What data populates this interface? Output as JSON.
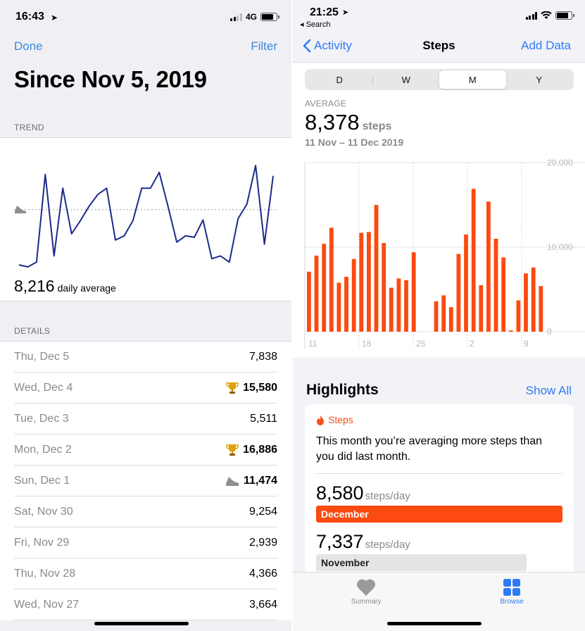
{
  "left": {
    "status": {
      "time": "16:43",
      "network": "4G"
    },
    "nav": {
      "done": "Done",
      "filter": "Filter"
    },
    "title": "Since Nov 5, 2019",
    "trend_header": "TREND",
    "average_value": "8,216",
    "average_label": "daily average",
    "details_header": "DETAILS",
    "details": [
      {
        "date": "Thu, Dec 5",
        "value": "7,838",
        "badge": ""
      },
      {
        "date": "Wed, Dec 4",
        "value": "15,580",
        "badge": "trophy-icon"
      },
      {
        "date": "Tue, Dec 3",
        "value": "5,511",
        "badge": ""
      },
      {
        "date": "Mon, Dec 2",
        "value": "16,886",
        "badge": "trophy-icon"
      },
      {
        "date": "Sun, Dec 1",
        "value": "11,474",
        "badge": "shoe-icon"
      },
      {
        "date": "Sat, Nov 30",
        "value": "9,254",
        "badge": ""
      },
      {
        "date": "Fri, Nov 29",
        "value": "2,939",
        "badge": ""
      },
      {
        "date": "Thu, Nov 28",
        "value": "4,366",
        "badge": ""
      },
      {
        "date": "Wed, Nov 27",
        "value": "3,664",
        "badge": ""
      }
    ],
    "trend_line": [
      2500,
      2200,
      2900,
      15600,
      3800,
      13600,
      7000,
      8900,
      11000,
      12700,
      13600,
      6100,
      6700,
      8900,
      13600,
      13600,
      15900,
      11000,
      5800,
      6700,
      6500,
      9000,
      3400,
      3800,
      2900,
      9200,
      11300,
      16900,
      5500,
      15400
    ],
    "trend_ref": 10500
  },
  "right": {
    "status": {
      "time": "21:25",
      "back_app": "◂ Search"
    },
    "nav": {
      "back": "Activity",
      "title": "Steps",
      "add": "Add Data"
    },
    "segments": [
      "D",
      "W",
      "M",
      "Y"
    ],
    "selected_segment": "M",
    "average_key": "AVERAGE",
    "average_value": "8,378",
    "average_unit": "steps",
    "range": "11 Nov – 11 Dec 2019",
    "highlights_title": "Highlights",
    "show_all": "Show All",
    "card": {
      "tag": "Steps",
      "text": "This month you’re averaging more steps than you did last month.",
      "current_value": "8,580",
      "current_unit": "steps/day",
      "current_label": "December",
      "previous_value": "7,337",
      "previous_unit": "steps/day",
      "previous_label": "November"
    },
    "tabs": {
      "summary": "Summary",
      "browse": "Browse"
    }
  },
  "chart_data": {
    "type": "bar",
    "categories": [
      "11",
      "12",
      "13",
      "14",
      "15",
      "16",
      "17",
      "18",
      "19",
      "20",
      "21",
      "22",
      "23",
      "24",
      "25",
      "26",
      "27",
      "28",
      "29",
      "30",
      "1",
      "2",
      "3",
      "4",
      "5",
      "6",
      "7",
      "8",
      "9",
      "10",
      "11"
    ],
    "values": [
      7100,
      9000,
      10400,
      12300,
      5800,
      6500,
      8600,
      11700,
      11800,
      15000,
      10500,
      5200,
      6300,
      6100,
      9400,
      0,
      0,
      3600,
      4300,
      2900,
      9200,
      11500,
      16900,
      5500,
      15400,
      11000,
      8800,
      150,
      3700,
      6900,
      7600,
      5400
    ],
    "ylim": [
      0,
      20000
    ],
    "ytick_labels": [
      "20,000",
      "10,000",
      "0"
    ],
    "xtick_labels": [
      "11",
      "18",
      "25",
      "2",
      "9"
    ],
    "color": "#fc4a10",
    "grid": true
  }
}
